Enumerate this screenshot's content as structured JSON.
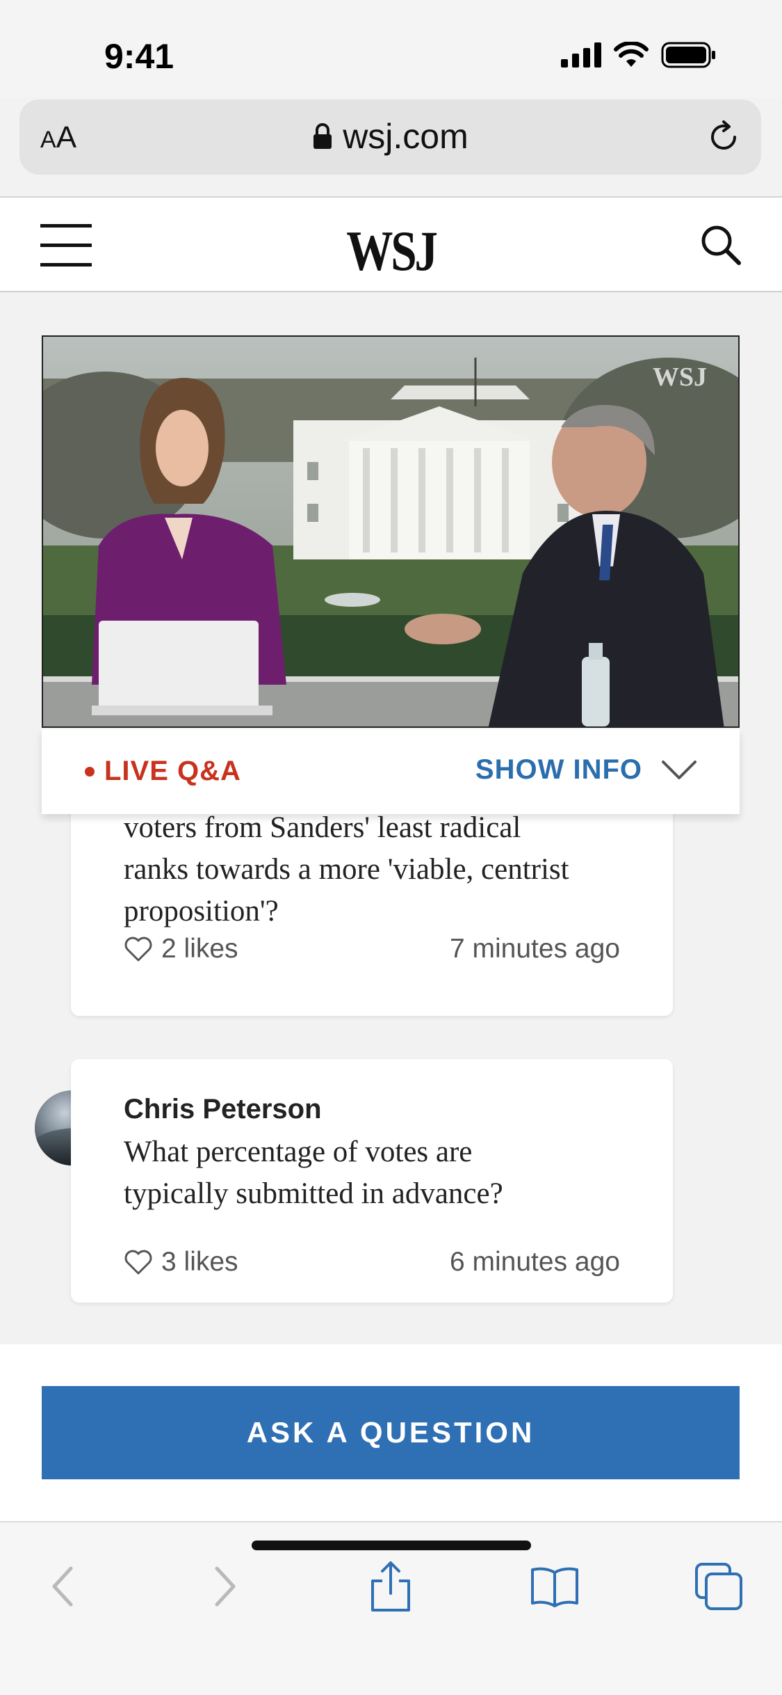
{
  "status_bar": {
    "time": "9:41"
  },
  "browser": {
    "text_size_label_small": "A",
    "text_size_label_large": "A",
    "url": "wsj.com"
  },
  "site": {
    "logo": "WSJ"
  },
  "video": {
    "watermark": "WSJ",
    "live_label": "LIVE Q&A",
    "show_info_label": "SHOW INFO"
  },
  "questions": [
    {
      "author": "",
      "text_lines": [
        "voters from Sanders' least radical",
        "ranks towards a more 'viable, centrist",
        "proposition'?"
      ],
      "likes": "2 likes",
      "time": "7 minutes ago"
    },
    {
      "author": "Chris Peterson",
      "text_lines": [
        "What percentage of votes are",
        "typically submitted in advance?"
      ],
      "likes": "3 likes",
      "time": "6 minutes ago"
    }
  ],
  "cta": {
    "label": "ASK A QUESTION"
  },
  "colors": {
    "accent_blue": "#2f6fb3",
    "live_red": "#c8321e"
  },
  "icons": {
    "menu": "hamburger-icon",
    "search": "search-icon",
    "lock": "lock-icon",
    "reload": "reload-icon",
    "like": "heart-icon",
    "chevron": "chevron-down-icon",
    "back": "back-arrow-icon",
    "forward": "forward-arrow-icon",
    "share": "share-icon",
    "bookmarks": "book-icon",
    "tabs": "tabs-icon"
  }
}
